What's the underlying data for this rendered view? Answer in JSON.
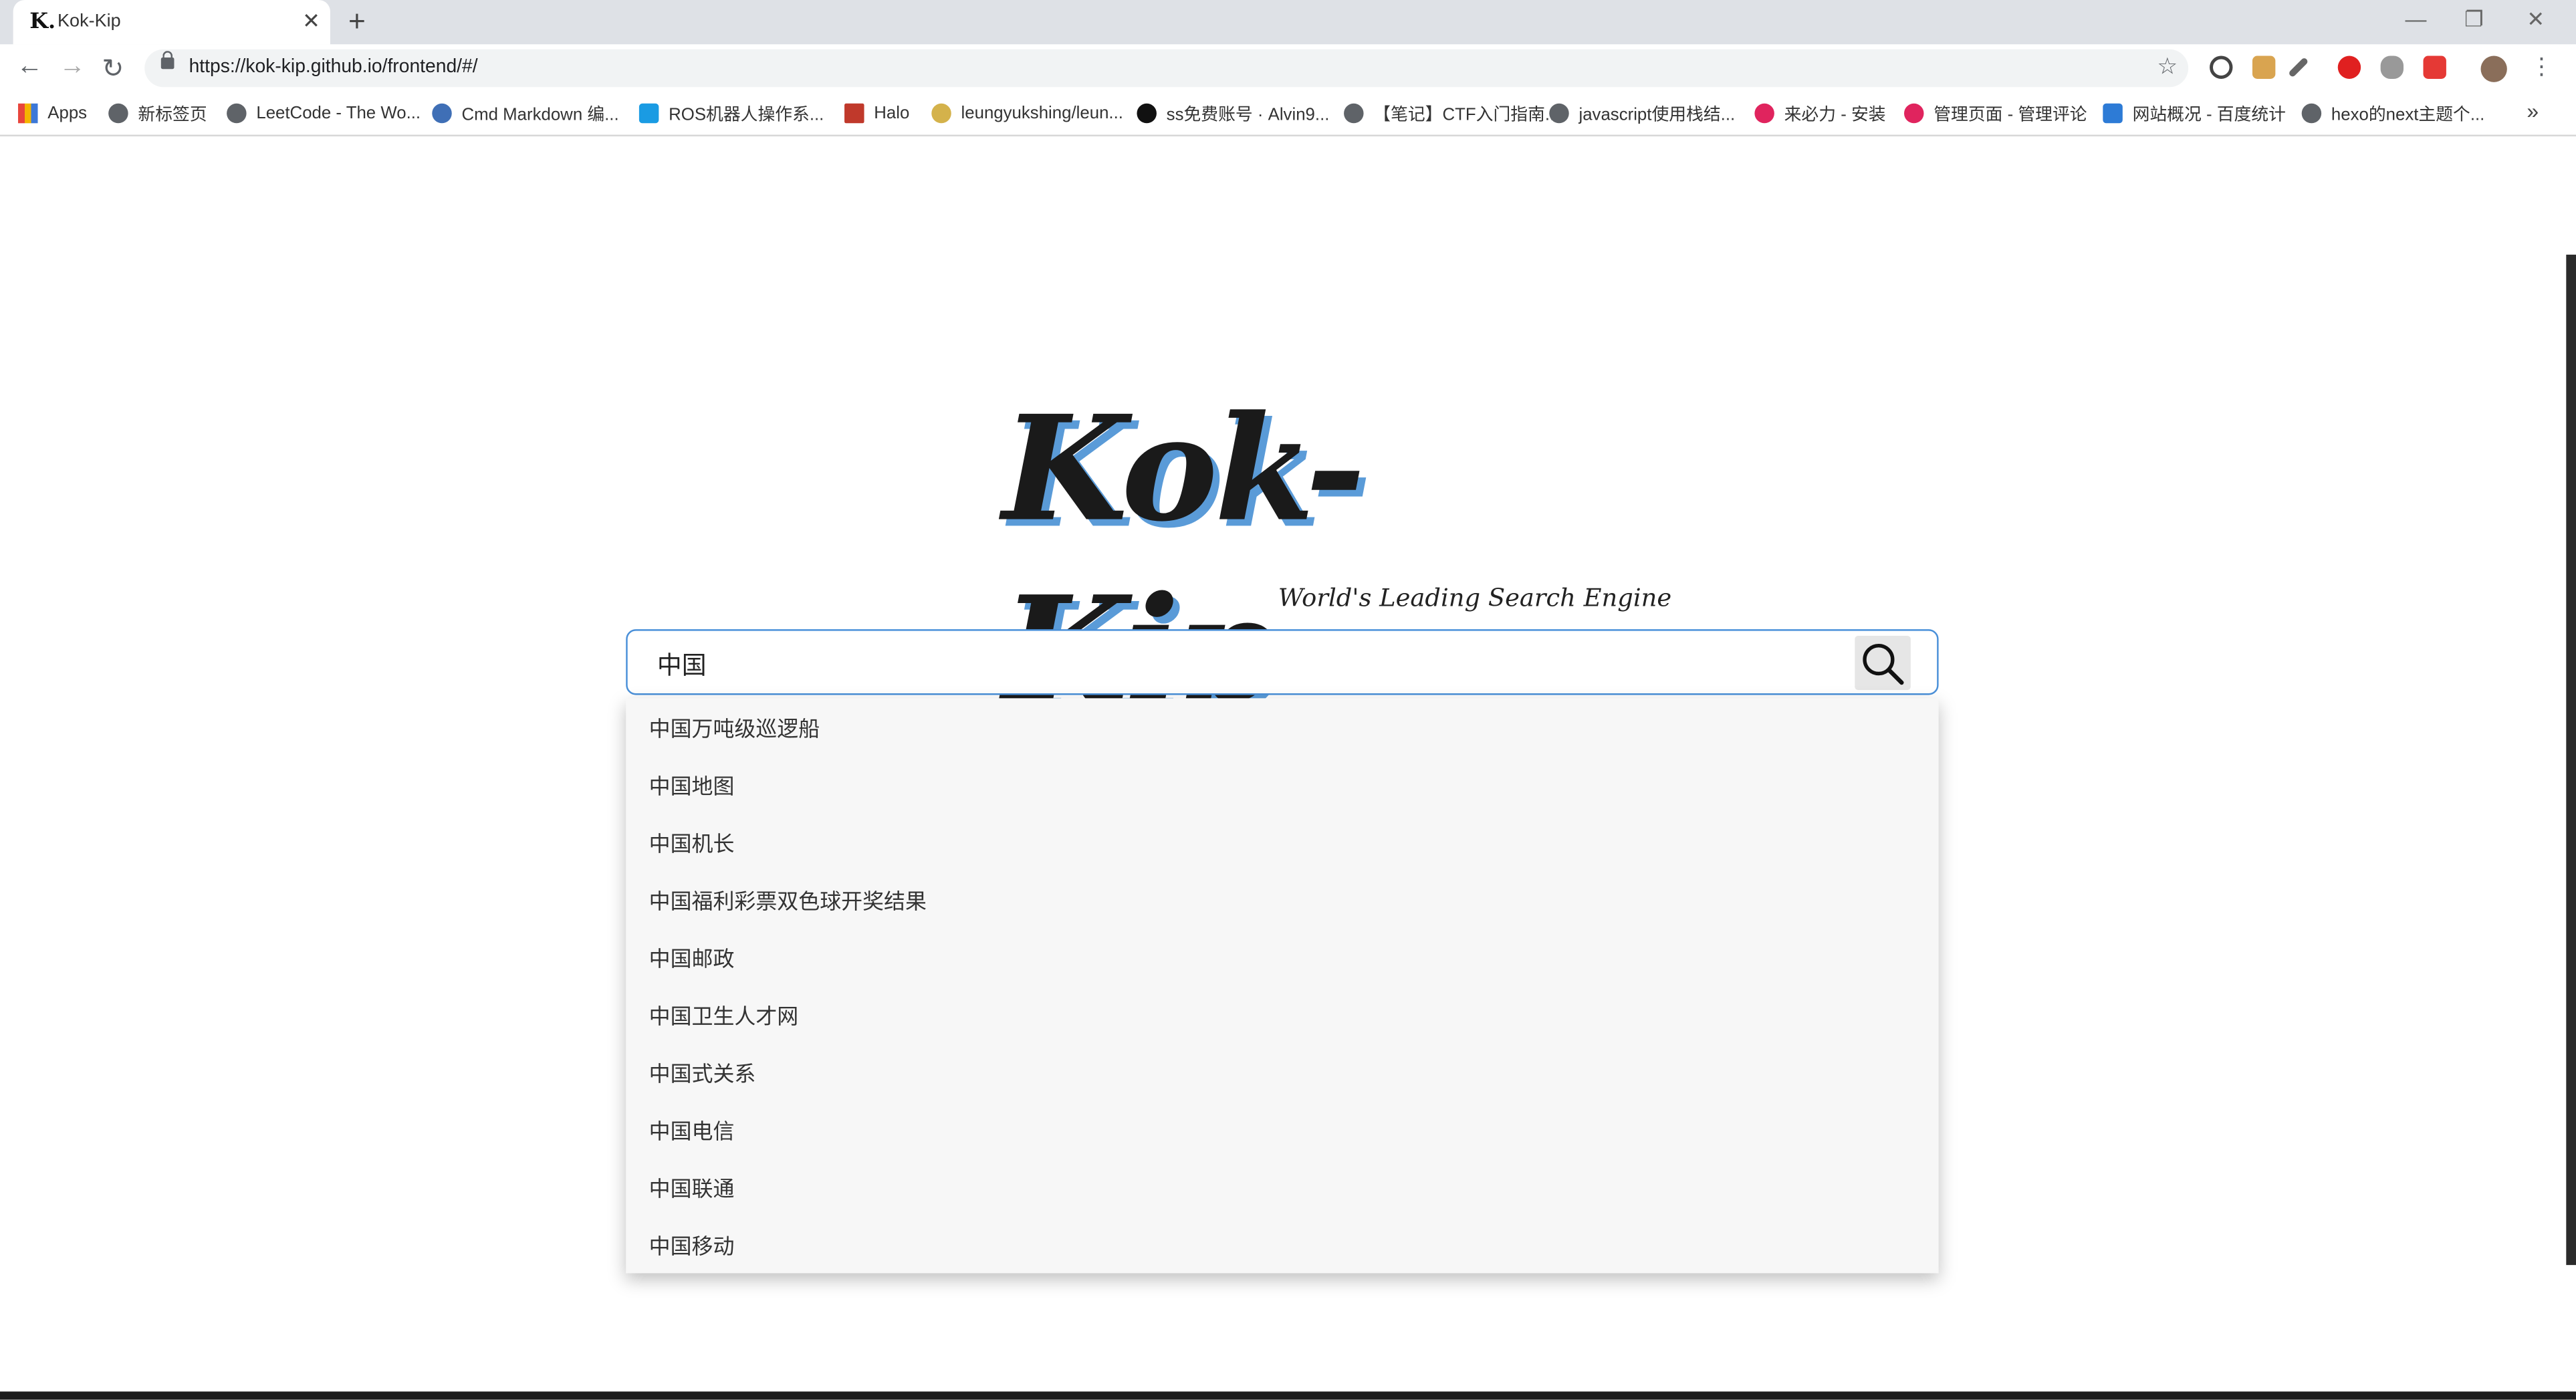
{
  "browser": {
    "tab_title": "Kok-Kip",
    "tab_favicon": "K.",
    "url": "https://kok-kip.github.io/frontend/#/"
  },
  "bookmarks": [
    {
      "label": "Apps",
      "color": "#e8453c"
    },
    {
      "label": "新标签页",
      "color": "#5f6368"
    },
    {
      "label": "LeetCode - The Wo...",
      "color": "#5f6368"
    },
    {
      "label": "Cmd Markdown 编...",
      "color": "#3f6fb6"
    },
    {
      "label": "ROS机器人操作系...",
      "color": "#1a9be3"
    },
    {
      "label": "Halo",
      "color": "#c0392b"
    },
    {
      "label": "leungyukshing/leun...",
      "color": "#d4b24b"
    },
    {
      "label": "ss免费账号 · Alvin9...",
      "color": "#111111"
    },
    {
      "label": "【笔记】CTF入门指南...",
      "color": "#5f6368"
    },
    {
      "label": "javascript使用栈结...",
      "color": "#5f6368"
    },
    {
      "label": "来必力 - 安装",
      "color": "#e0245e"
    },
    {
      "label": "管理页面 - 管理评论",
      "color": "#e0245e"
    },
    {
      "label": "网站概况 - 百度统计",
      "color": "#2d7bd6"
    },
    {
      "label": "hexo的next主题个...",
      "color": "#5f6368"
    }
  ],
  "page": {
    "logo": "Kok-Kip",
    "tagline": "World's Leading Search Engine",
    "search_value": "中国",
    "suggestions": [
      "中国万吨级巡逻船",
      "中国地图",
      "中国机长",
      "中国福利彩票双色球开奖结果",
      "中国邮政",
      "中国卫生人才网",
      "中国式关系",
      "中国电信",
      "中国联通",
      "中国移动"
    ]
  }
}
